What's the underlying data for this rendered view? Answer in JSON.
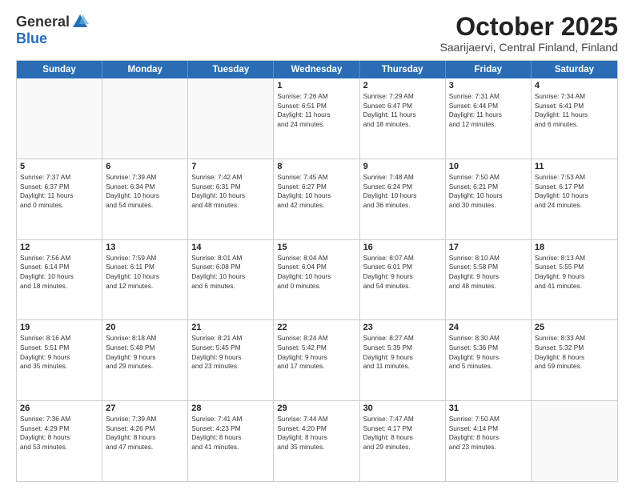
{
  "header": {
    "logo_general": "General",
    "logo_blue": "Blue",
    "month_title": "October 2025",
    "subtitle": "Saarijaervi, Central Finland, Finland"
  },
  "weekdays": [
    "Sunday",
    "Monday",
    "Tuesday",
    "Wednesday",
    "Thursday",
    "Friday",
    "Saturday"
  ],
  "rows": [
    [
      {
        "day": "",
        "info": ""
      },
      {
        "day": "",
        "info": ""
      },
      {
        "day": "",
        "info": ""
      },
      {
        "day": "1",
        "info": "Sunrise: 7:26 AM\nSunset: 6:51 PM\nDaylight: 11 hours\nand 24 minutes."
      },
      {
        "day": "2",
        "info": "Sunrise: 7:29 AM\nSunset: 6:47 PM\nDaylight: 11 hours\nand 18 minutes."
      },
      {
        "day": "3",
        "info": "Sunrise: 7:31 AM\nSunset: 6:44 PM\nDaylight: 11 hours\nand 12 minutes."
      },
      {
        "day": "4",
        "info": "Sunrise: 7:34 AM\nSunset: 6:41 PM\nDaylight: 11 hours\nand 6 minutes."
      }
    ],
    [
      {
        "day": "5",
        "info": "Sunrise: 7:37 AM\nSunset: 6:37 PM\nDaylight: 11 hours\nand 0 minutes."
      },
      {
        "day": "6",
        "info": "Sunrise: 7:39 AM\nSunset: 6:34 PM\nDaylight: 10 hours\nand 54 minutes."
      },
      {
        "day": "7",
        "info": "Sunrise: 7:42 AM\nSunset: 6:31 PM\nDaylight: 10 hours\nand 48 minutes."
      },
      {
        "day": "8",
        "info": "Sunrise: 7:45 AM\nSunset: 6:27 PM\nDaylight: 10 hours\nand 42 minutes."
      },
      {
        "day": "9",
        "info": "Sunrise: 7:48 AM\nSunset: 6:24 PM\nDaylight: 10 hours\nand 36 minutes."
      },
      {
        "day": "10",
        "info": "Sunrise: 7:50 AM\nSunset: 6:21 PM\nDaylight: 10 hours\nand 30 minutes."
      },
      {
        "day": "11",
        "info": "Sunrise: 7:53 AM\nSunset: 6:17 PM\nDaylight: 10 hours\nand 24 minutes."
      }
    ],
    [
      {
        "day": "12",
        "info": "Sunrise: 7:56 AM\nSunset: 6:14 PM\nDaylight: 10 hours\nand 18 minutes."
      },
      {
        "day": "13",
        "info": "Sunrise: 7:59 AM\nSunset: 6:11 PM\nDaylight: 10 hours\nand 12 minutes."
      },
      {
        "day": "14",
        "info": "Sunrise: 8:01 AM\nSunset: 6:08 PM\nDaylight: 10 hours\nand 6 minutes."
      },
      {
        "day": "15",
        "info": "Sunrise: 8:04 AM\nSunset: 6:04 PM\nDaylight: 10 hours\nand 0 minutes."
      },
      {
        "day": "16",
        "info": "Sunrise: 8:07 AM\nSunset: 6:01 PM\nDaylight: 9 hours\nand 54 minutes."
      },
      {
        "day": "17",
        "info": "Sunrise: 8:10 AM\nSunset: 5:58 PM\nDaylight: 9 hours\nand 48 minutes."
      },
      {
        "day": "18",
        "info": "Sunrise: 8:13 AM\nSunset: 5:55 PM\nDaylight: 9 hours\nand 41 minutes."
      }
    ],
    [
      {
        "day": "19",
        "info": "Sunrise: 8:16 AM\nSunset: 5:51 PM\nDaylight: 9 hours\nand 35 minutes."
      },
      {
        "day": "20",
        "info": "Sunrise: 8:18 AM\nSunset: 5:48 PM\nDaylight: 9 hours\nand 29 minutes."
      },
      {
        "day": "21",
        "info": "Sunrise: 8:21 AM\nSunset: 5:45 PM\nDaylight: 9 hours\nand 23 minutes."
      },
      {
        "day": "22",
        "info": "Sunrise: 8:24 AM\nSunset: 5:42 PM\nDaylight: 9 hours\nand 17 minutes."
      },
      {
        "day": "23",
        "info": "Sunrise: 8:27 AM\nSunset: 5:39 PM\nDaylight: 9 hours\nand 11 minutes."
      },
      {
        "day": "24",
        "info": "Sunrise: 8:30 AM\nSunset: 5:36 PM\nDaylight: 9 hours\nand 5 minutes."
      },
      {
        "day": "25",
        "info": "Sunrise: 8:33 AM\nSunset: 5:32 PM\nDaylight: 8 hours\nand 59 minutes."
      }
    ],
    [
      {
        "day": "26",
        "info": "Sunrise: 7:36 AM\nSunset: 4:29 PM\nDaylight: 8 hours\nand 53 minutes."
      },
      {
        "day": "27",
        "info": "Sunrise: 7:39 AM\nSunset: 4:26 PM\nDaylight: 8 hours\nand 47 minutes."
      },
      {
        "day": "28",
        "info": "Sunrise: 7:41 AM\nSunset: 4:23 PM\nDaylight: 8 hours\nand 41 minutes."
      },
      {
        "day": "29",
        "info": "Sunrise: 7:44 AM\nSunset: 4:20 PM\nDaylight: 8 hours\nand 35 minutes."
      },
      {
        "day": "30",
        "info": "Sunrise: 7:47 AM\nSunset: 4:17 PM\nDaylight: 8 hours\nand 29 minutes."
      },
      {
        "day": "31",
        "info": "Sunrise: 7:50 AM\nSunset: 4:14 PM\nDaylight: 8 hours\nand 23 minutes."
      },
      {
        "day": "",
        "info": ""
      }
    ]
  ]
}
